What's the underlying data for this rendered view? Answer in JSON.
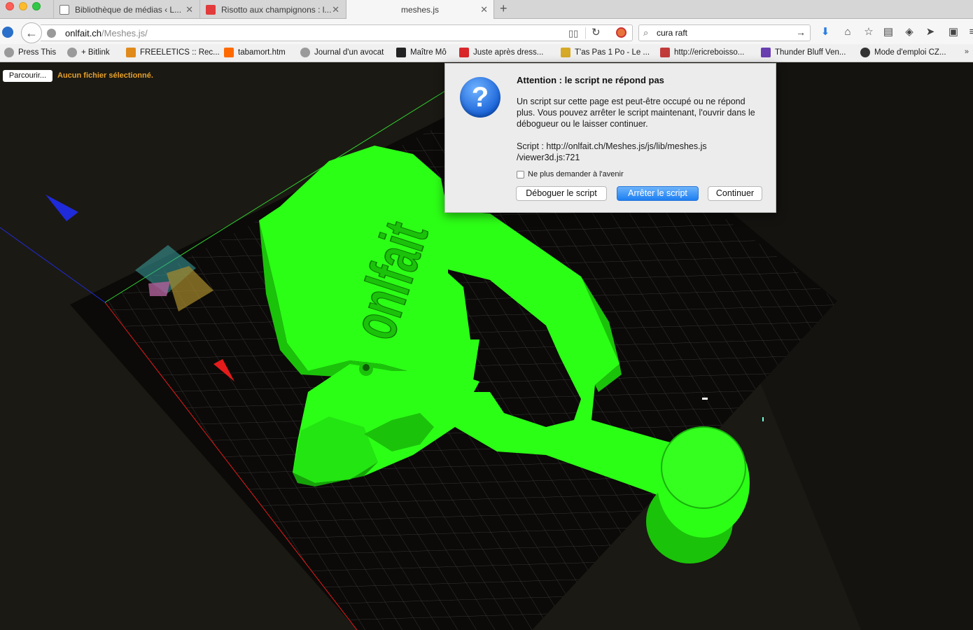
{
  "tabs": [
    {
      "label": "Bibliothèque de médias ‹ L...",
      "close": "✕"
    },
    {
      "label": "Risotto aux champignons : l...",
      "close": "✕"
    },
    {
      "label": "meshes.js",
      "close": "✕"
    }
  ],
  "new_tab": "+",
  "nav": {
    "url_host": "onlfait.ch",
    "url_path": "/Meshes.js/",
    "search_value": "cura raft"
  },
  "bookmarks": [
    {
      "label": "Press This",
      "color": "#9a9a9a"
    },
    {
      "label": "+ Bitlink",
      "color": "#9a9a9a"
    },
    {
      "label": "FREELETICS :: Rec...",
      "color": "#e08a1c"
    },
    {
      "label": "tabamort.htm",
      "color": "#ff6a00"
    },
    {
      "label": "Journal d'un avocat",
      "color": "#9a9a9a"
    },
    {
      "label": "Maître Mô",
      "color": "#222222"
    },
    {
      "label": "Juste après dress...",
      "color": "#d9262b"
    },
    {
      "label": "T'as Pas 1 Po - Le ...",
      "color": "#d6a928"
    },
    {
      "label": "http://ericreboisso...",
      "color": "#c23b3b"
    },
    {
      "label": "Thunder Bluff Ven...",
      "color": "#6a3fb0"
    },
    {
      "label": "Mode d'emploi CZ...",
      "color": "#333333"
    }
  ],
  "bookmarks_more": "»",
  "page": {
    "file_button": "Parcourir...",
    "file_status": "Aucun fichier sélectionné."
  },
  "dialog": {
    "icon": "?",
    "title": "Attention : le script ne répond pas",
    "message": "Un script sur cette page est peut-être occupé ou ne répond plus. Vous pouvez arrêter le script maintenant, l'ouvrir dans le débogueur ou le laisser continuer.",
    "script_line1": "Script : http://onlfait.ch/Meshes.js/js/lib/meshes.js",
    "script_line2": "/viewer3d.js:721",
    "checkbox_label": "Ne plus demander à l'avenir",
    "btn_debug": "Déboguer le script",
    "btn_stop": "Arrêter le script",
    "btn_continue": "Continuer"
  },
  "scene": {
    "model_color": "#2cff16",
    "model_shade": "#1bc20a",
    "model_text": "onlfait",
    "axis_x_color": "#e51b1b",
    "axis_y_color": "#30d030",
    "axis_z_color": "#1f2bd9",
    "grid_color": "#3a3a3a"
  }
}
